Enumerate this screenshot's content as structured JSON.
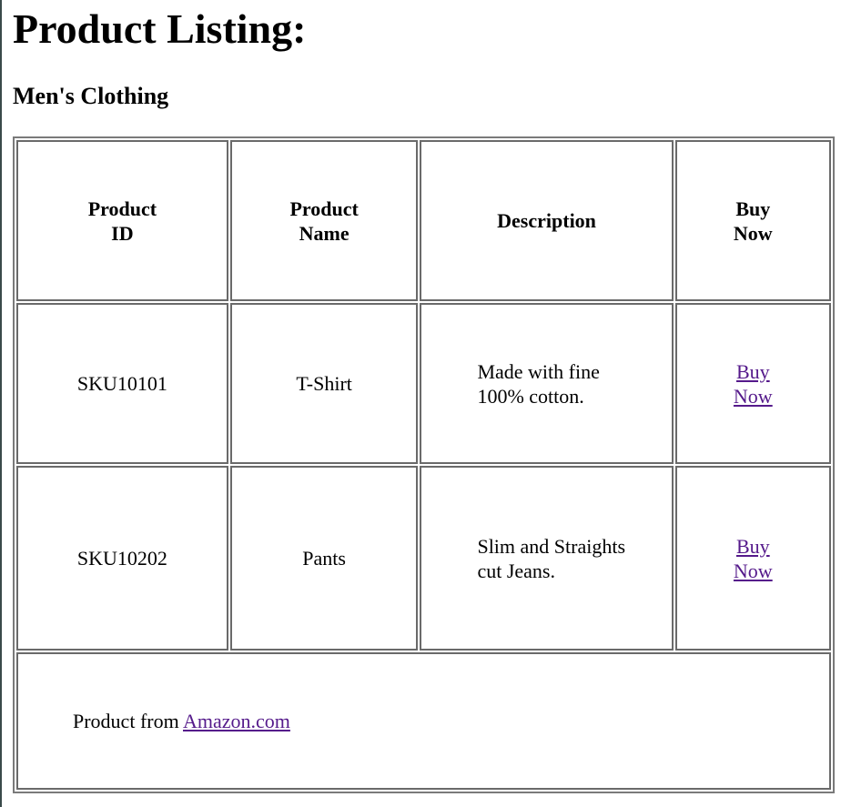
{
  "page": {
    "title": "Product Listing:",
    "section": "Men's Clothing"
  },
  "table": {
    "headers": [
      "Product ID",
      "Product Name",
      "Description",
      "Buy Now"
    ],
    "rows": [
      {
        "id": "SKU10101",
        "name": "T-Shirt",
        "description": "Made with fine 100% cotton.",
        "buy_label": "Buy Now"
      },
      {
        "id": "SKU10202",
        "name": "Pants",
        "description": "Slim and Straights cut Jeans.",
        "buy_label": "Buy Now"
      }
    ],
    "footer": {
      "prefix": "Product from ",
      "link_text": "Amazon.com"
    }
  },
  "colors": {
    "link": "#551a8b",
    "border": "#6a6a6a"
  }
}
